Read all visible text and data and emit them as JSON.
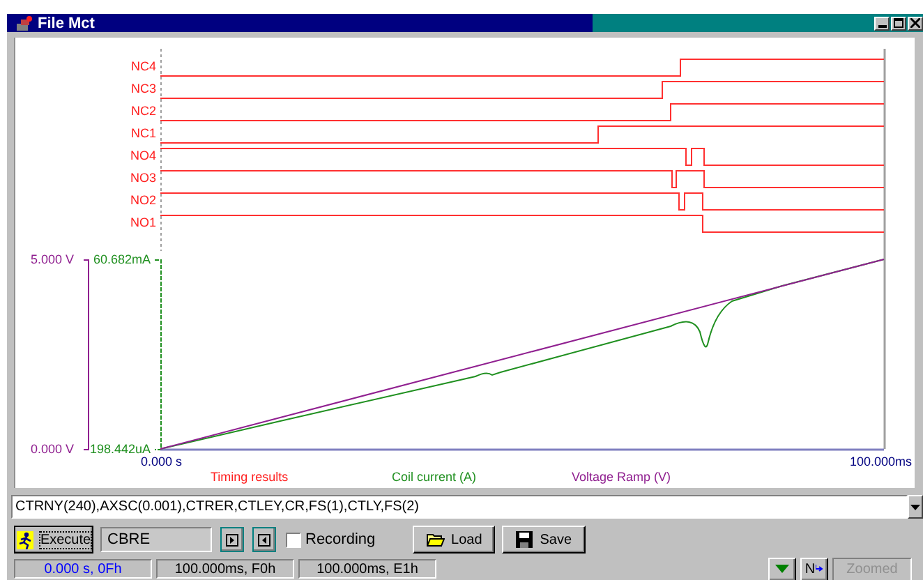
{
  "window": {
    "title": "File Mct"
  },
  "plot": {
    "channels": [
      {
        "name": "NC4"
      },
      {
        "name": "NC3"
      },
      {
        "name": "NC2"
      },
      {
        "name": "NC1"
      },
      {
        "name": "NO4"
      },
      {
        "name": "NO3"
      },
      {
        "name": "NO2"
      },
      {
        "name": "NO1"
      }
    ],
    "left_axis": {
      "max": "5.000 V",
      "min": "0.000 V"
    },
    "right_axis": {
      "max": "60.682mA",
      "min": "198.442uA"
    },
    "x_axis": {
      "start": "0.000 s",
      "end": "100.000ms"
    },
    "legend": [
      {
        "label": "Timing results",
        "color": "#ff2020"
      },
      {
        "label": "Coil current (A)",
        "color": "#209020"
      },
      {
        "label": "Voltage Ramp (V)",
        "color": "#902090"
      }
    ]
  },
  "command": {
    "value": "CTRNY(240),AXSC(0.001),CTRER,CTLEY,CR,FS(1),CTLY,FS(2)"
  },
  "toolbar": {
    "execute": "Execute",
    "mode": "CBRE",
    "recording": {
      "label": "Recording",
      "checked": false
    },
    "load": "Load",
    "save": "Save",
    "n_button": "N",
    "zoomed": {
      "label": "Zoomed",
      "disabled": true
    }
  },
  "status": [
    {
      "text": "0.000 s, 0Fh",
      "color": "#0000ff"
    },
    {
      "text": "100.000ms, F0h",
      "color": "#000000"
    },
    {
      "text": "100.000ms, E1h",
      "color": "#000000"
    }
  ]
}
